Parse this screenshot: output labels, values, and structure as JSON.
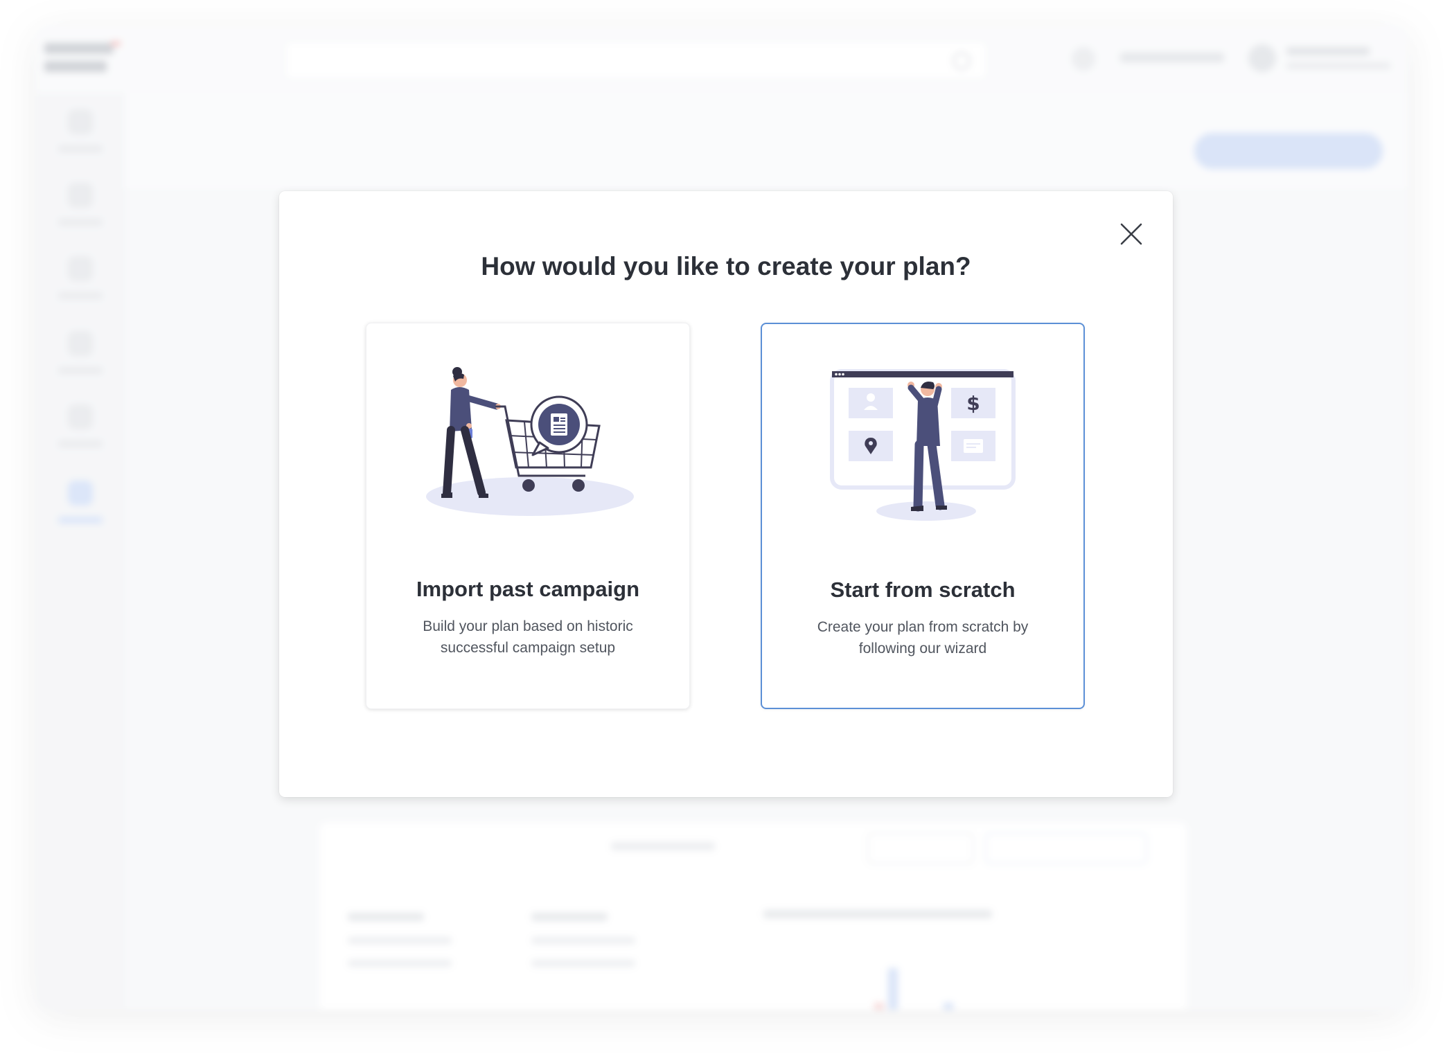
{
  "modal": {
    "title": "How would you like to create your plan?",
    "close_icon": "close-icon"
  },
  "options": [
    {
      "title": "Import past campaign",
      "description": "Build your plan based on historic successful campaign setup",
      "illustration": "shopping-cart-illustration",
      "selected": false
    },
    {
      "title": "Start from scratch",
      "description": "Create your plan from scratch by following our wizard",
      "illustration": "dashboard-builder-illustration",
      "selected": true
    }
  ],
  "colors": {
    "accent": "#5b8fd6",
    "illustration_primary": "#4b4f7a",
    "illustration_soft": "#e6e8f7"
  }
}
